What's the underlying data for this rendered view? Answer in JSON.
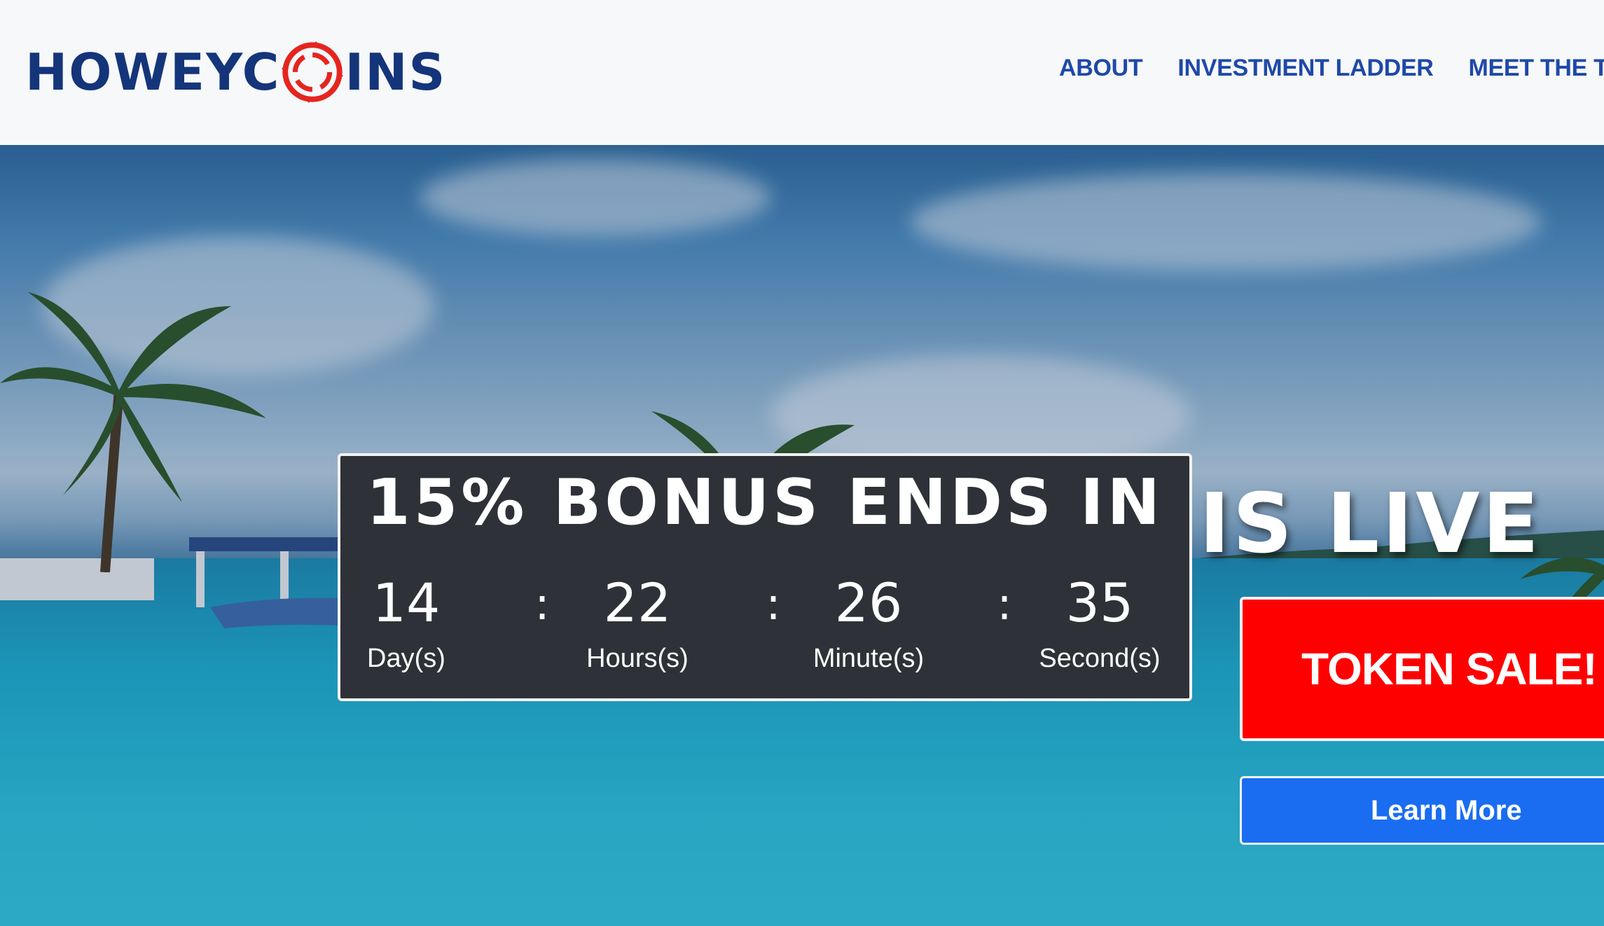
{
  "brand": {
    "logo_text_left": "HOWEYC",
    "logo_text_right": "INS",
    "logo_aria": "HOWEYCOINS",
    "colors": {
      "navy": "#14357a",
      "red": "#e5251f",
      "nav_blue": "#1e49a8"
    }
  },
  "nav": {
    "items": [
      {
        "label": "ABOUT"
      },
      {
        "label": "INVESTMENT LADDER"
      },
      {
        "label": "MEET THE TEA"
      }
    ]
  },
  "hero": {
    "headline": "PRE-ICO SALE IS LIVE",
    "countdown": {
      "title": "15% BONUS ENDS IN",
      "separator": ":",
      "units": [
        {
          "value": "14",
          "label": "Day(s)"
        },
        {
          "value": "22",
          "label": "Hours(s)"
        },
        {
          "value": "26",
          "label": "Minute(s)"
        },
        {
          "value": "35",
          "label": "Second(s)"
        }
      ]
    },
    "token_button": {
      "label": "TOKEN SALE!",
      "color": "#ff0000"
    },
    "learn_button": {
      "label": "Learn More",
      "color": "#1a6df0"
    }
  }
}
